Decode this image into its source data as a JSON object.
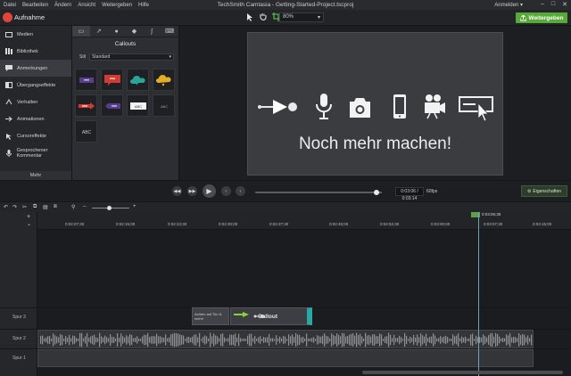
{
  "app": {
    "title": "TechSmith Camtasia - Getting-Started-Project.tscproj",
    "menus": [
      "Datei",
      "Bearbeiten",
      "Ändern",
      "Ansicht",
      "Weitergeben",
      "Hilfe"
    ],
    "account": "Anmelden ▾",
    "window_controls": [
      "–",
      "□",
      "✕"
    ]
  },
  "toolbar": {
    "record_label": "Aufnahme",
    "zoom_value": "80%",
    "export_label": "Weitergeben"
  },
  "sidebar": {
    "items": [
      {
        "label": "Medien",
        "icon": "media-icon"
      },
      {
        "label": "Bibliothek",
        "icon": "library-icon"
      },
      {
        "label": "Anmerkungen",
        "icon": "annotations-icon",
        "active": true
      },
      {
        "label": "Übergangseffekte",
        "icon": "transitions-icon"
      },
      {
        "label": "Verhalten",
        "icon": "behaviors-icon"
      },
      {
        "label": "Animationen",
        "icon": "animations-icon"
      },
      {
        "label": "Cursoreffekte",
        "icon": "cursor-effects-icon"
      },
      {
        "label": "Gesprochener Kommentar",
        "icon": "voice-narration-icon"
      }
    ],
    "more_label": "Mehr"
  },
  "panel": {
    "title": "Callouts",
    "style_label": "Stil",
    "style_value": "Standard",
    "thumbs": [
      "",
      "",
      "",
      "",
      "",
      "",
      "ABC",
      "ABC",
      "ABC"
    ]
  },
  "canvas": {
    "text": "Noch mehr machen!"
  },
  "playback": {
    "timecode": "0:03:06 / 0:03:14",
    "fps": "60fps",
    "properties_label": "Eigenschaften",
    "progress": 0.96
  },
  "timeline": {
    "ticks": [
      "0:02:07;30",
      "0:02:15;00",
      "0:02:22;30",
      "0:02:30;00",
      "0:02:37;30",
      "0:02:45;00",
      "0:02:52;30",
      "0:03:00;00",
      "0:03:07;30",
      "0:03:15;00"
    ],
    "playhead_time": "0:03:06;38",
    "tracks": [
      "Spur 3",
      "Spur 2",
      "Spur 1"
    ],
    "clip_text_label": "Achten auf Ton & mehr!",
    "callout_clip_label": "Callout"
  },
  "colors": {
    "accent_green": "#59a83a",
    "record_red": "#e0453a",
    "clip_teal": "#2aa9a4"
  }
}
